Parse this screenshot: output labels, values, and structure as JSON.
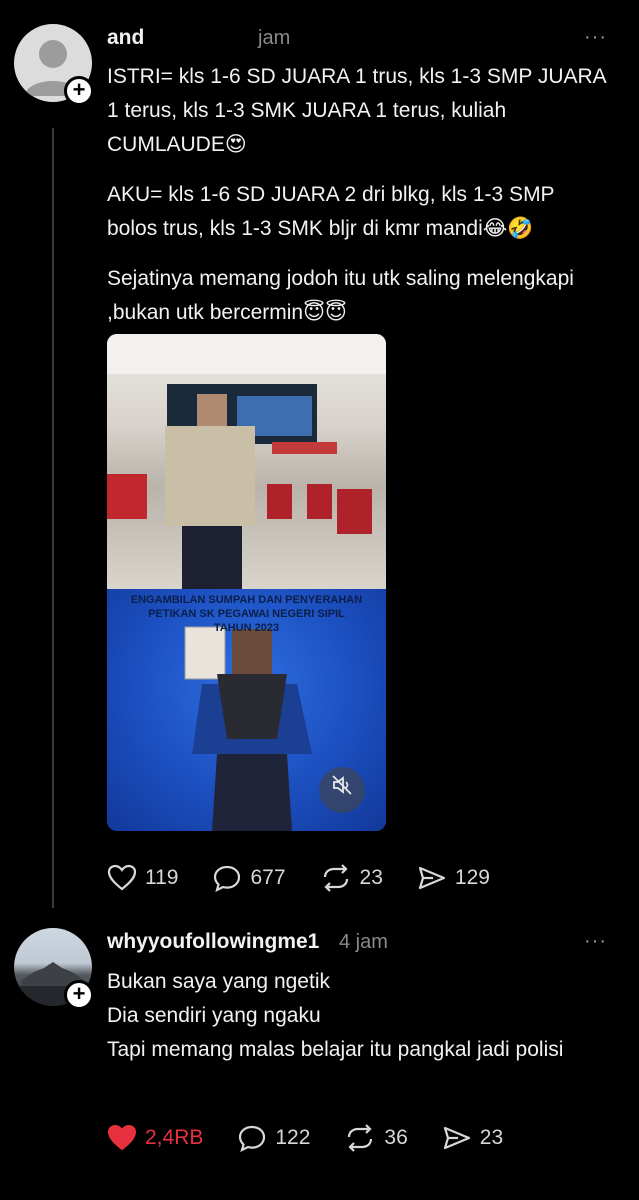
{
  "post1": {
    "username": "and",
    "timestamp": "jam",
    "more": "···",
    "paragraphs": [
      "ISTRI= kls 1-6 SD JUARA 1 trus, kls 1-3 SMP JUARA 1 terus, kls 1-3 SMK JUARA 1 terus, kuliah CUMLAUDE😍",
      "AKU= kls 1-6 SD JUARA 2 dri blkg, kls 1-3 SMP bolos trus, kls 1-3 SMK bljr di kmr mandi😂🤣",
      "Sejatinya memang jodoh itu utk saling melengkapi ,bukan utk bercermin😇😇"
    ],
    "media_banner": "ENGAMBILAN SUMPAH DAN PENYERAHAN\nPETIKAN SK PEGAWAI NEGERI SIPIL\nTAHUN 2023",
    "likes": "119",
    "replies": "677",
    "reposts": "23",
    "shares": "129"
  },
  "post2": {
    "username": "whyyoufollowingme1",
    "timestamp": "4 jam",
    "more": "···",
    "lines": [
      "Bukan saya yang ngetik",
      "Dia sendiri yang ngaku",
      "Tapi memang malas belajar itu pangkal jadi polisi"
    ],
    "likes": "2,4RB",
    "replies": "122",
    "reposts": "36",
    "shares": "23"
  },
  "colors": {
    "background": "#000000",
    "text": "#f2f2f2",
    "muted": "#8a8a8a",
    "like_active": "#e8313f"
  },
  "icons": [
    "person-icon",
    "plus-icon",
    "heart-icon",
    "comment-icon",
    "repost-icon",
    "share-icon",
    "mute-icon",
    "more-icon"
  ]
}
